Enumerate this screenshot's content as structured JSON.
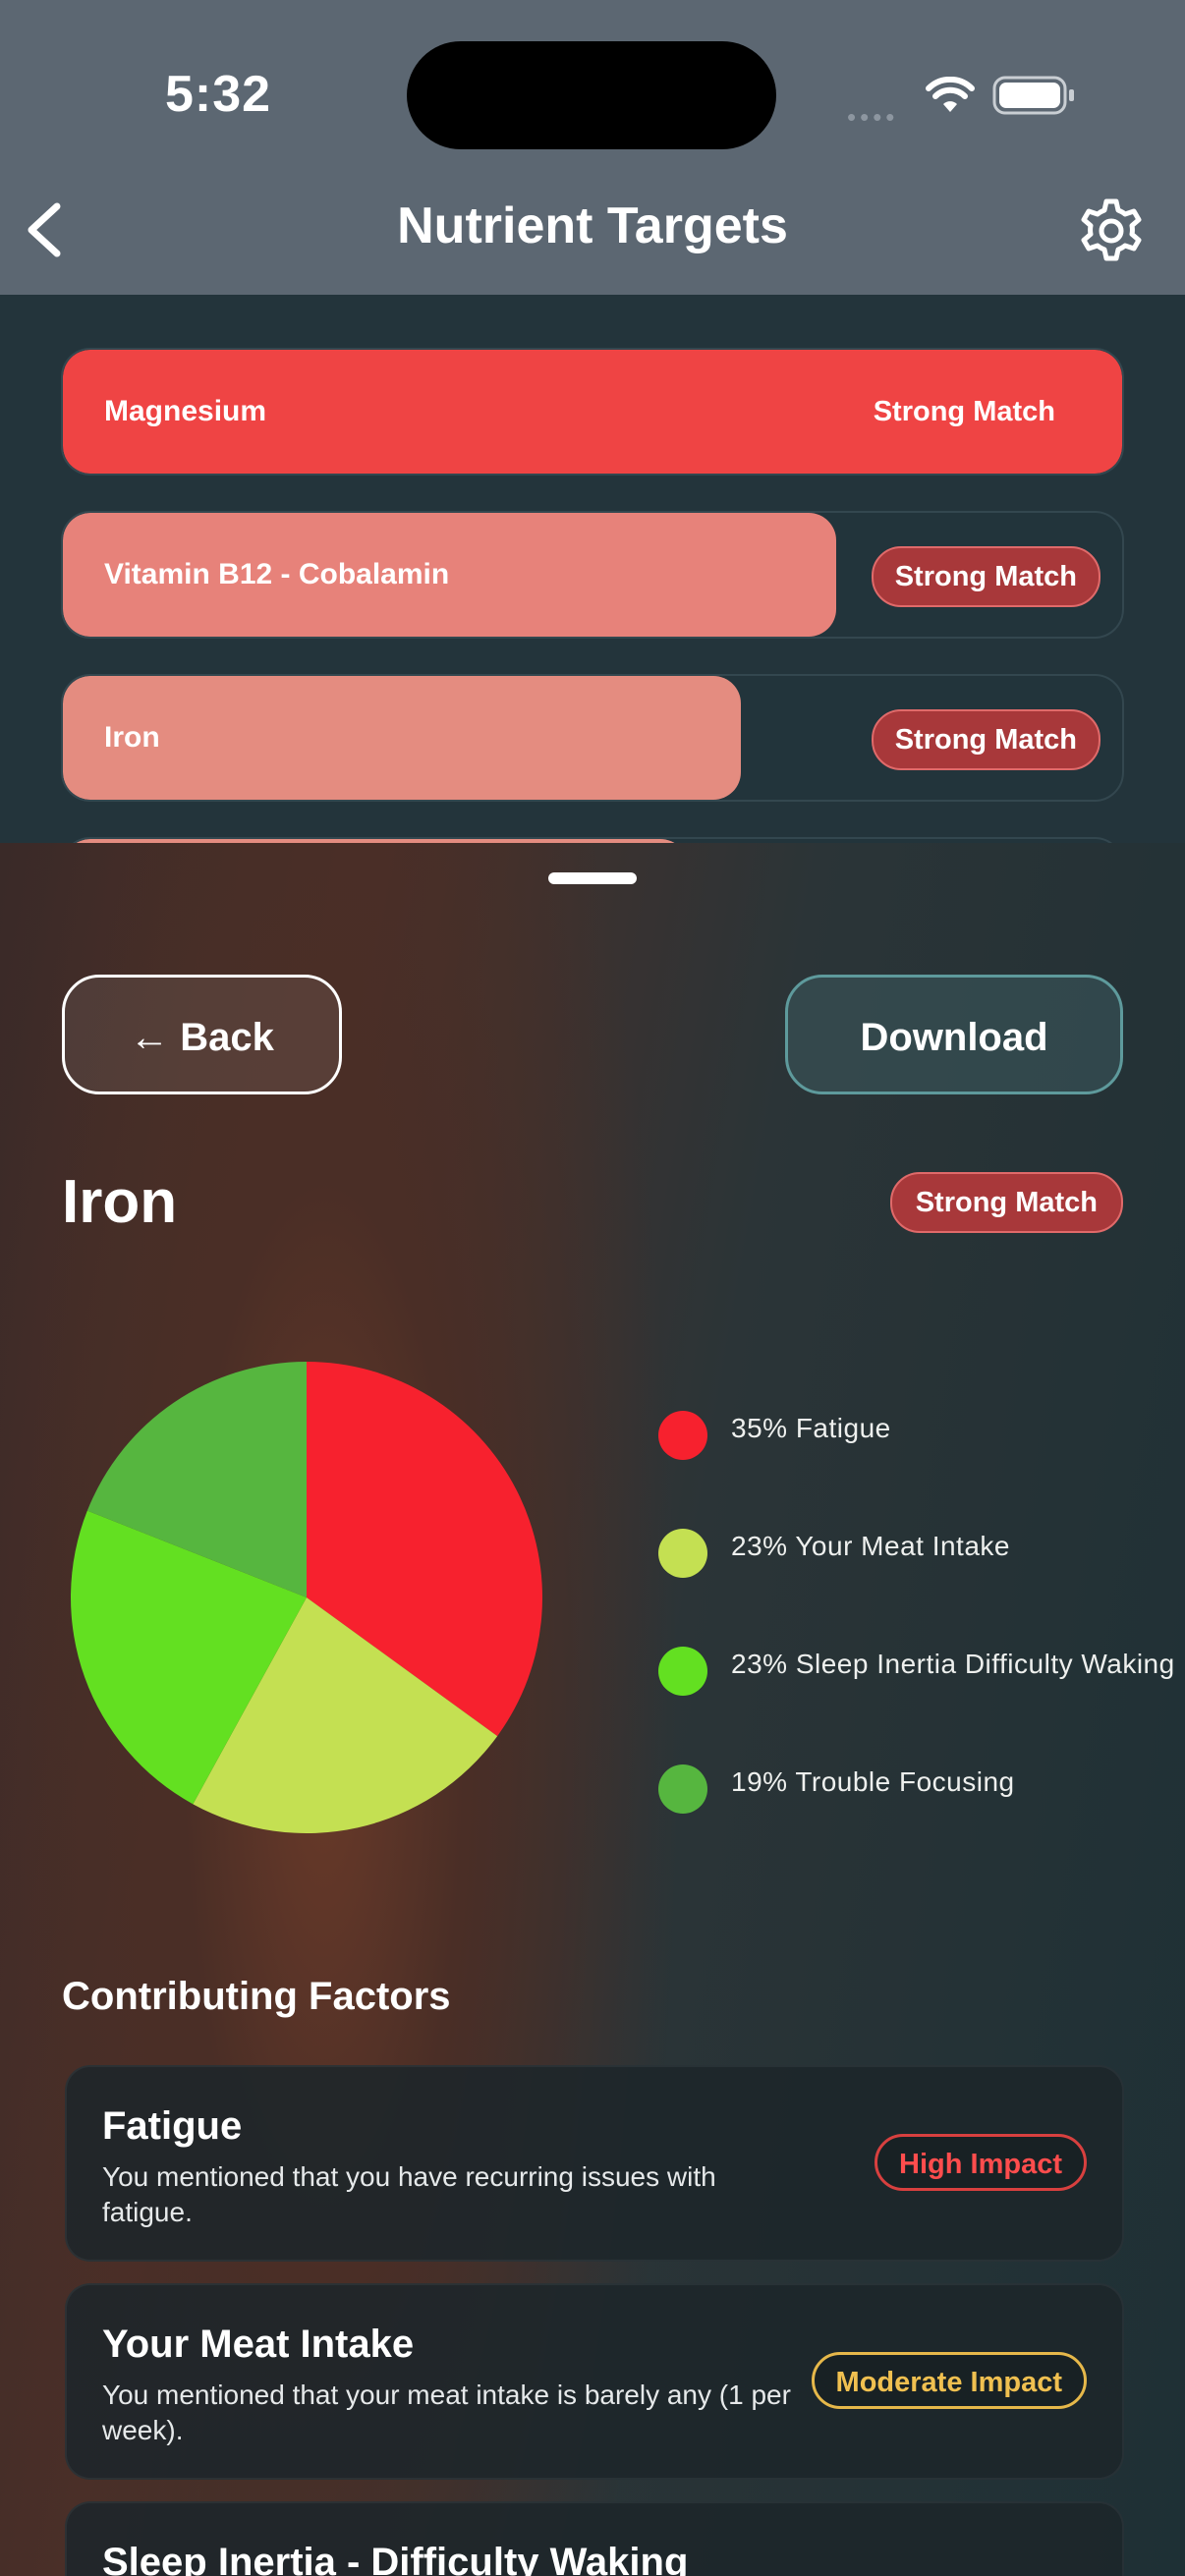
{
  "status_bar": {
    "time": "5:32"
  },
  "nav": {
    "title": "Nutrient Targets"
  },
  "nutrient_list": [
    {
      "label": "Magnesium",
      "tag": "Strong Match",
      "fill_percent": 100,
      "color": "#ef4444"
    },
    {
      "label": "Vitamin B12 - Cobalamin",
      "tag": "Strong Match",
      "fill_percent": 73,
      "color": "#e7827a"
    },
    {
      "label": "Iron",
      "tag": "Strong Match",
      "fill_percent": 64,
      "color": "#e48c80"
    },
    {
      "label": "",
      "tag": "",
      "fill_percent": 59,
      "color": "#e48c80"
    }
  ],
  "sheet": {
    "back_label": "← Back",
    "download_label": "Download",
    "title": "Iron",
    "badge": "Strong Match",
    "section_title": "Contributing Factors"
  },
  "chart_data": {
    "type": "pie",
    "title": "",
    "slices": [
      {
        "label": "35% Fatigue",
        "value": 35,
        "color": "#f7212e"
      },
      {
        "label": "23% Your Meat Intake",
        "value": 23,
        "color": "#c4e052"
      },
      {
        "label": "23% Sleep Inertia Difficulty Waking",
        "value": 23,
        "color": "#63e021"
      },
      {
        "label": "19% Trouble Focusing",
        "value": 19,
        "color": "#56b63f"
      }
    ]
  },
  "factors": [
    {
      "title": "Fatigue",
      "desc": "You mentioned that you have recurring issues with fatigue.",
      "impact": "High Impact",
      "level": "high"
    },
    {
      "title": "Your Meat Intake",
      "desc": "You mentioned that your meat intake is barely any (1 per week).",
      "impact": "Moderate Impact",
      "level": "moderate"
    },
    {
      "title": "Sleep Inertia - Difficulty Waking",
      "desc": "",
      "impact": "",
      "level": ""
    }
  ]
}
